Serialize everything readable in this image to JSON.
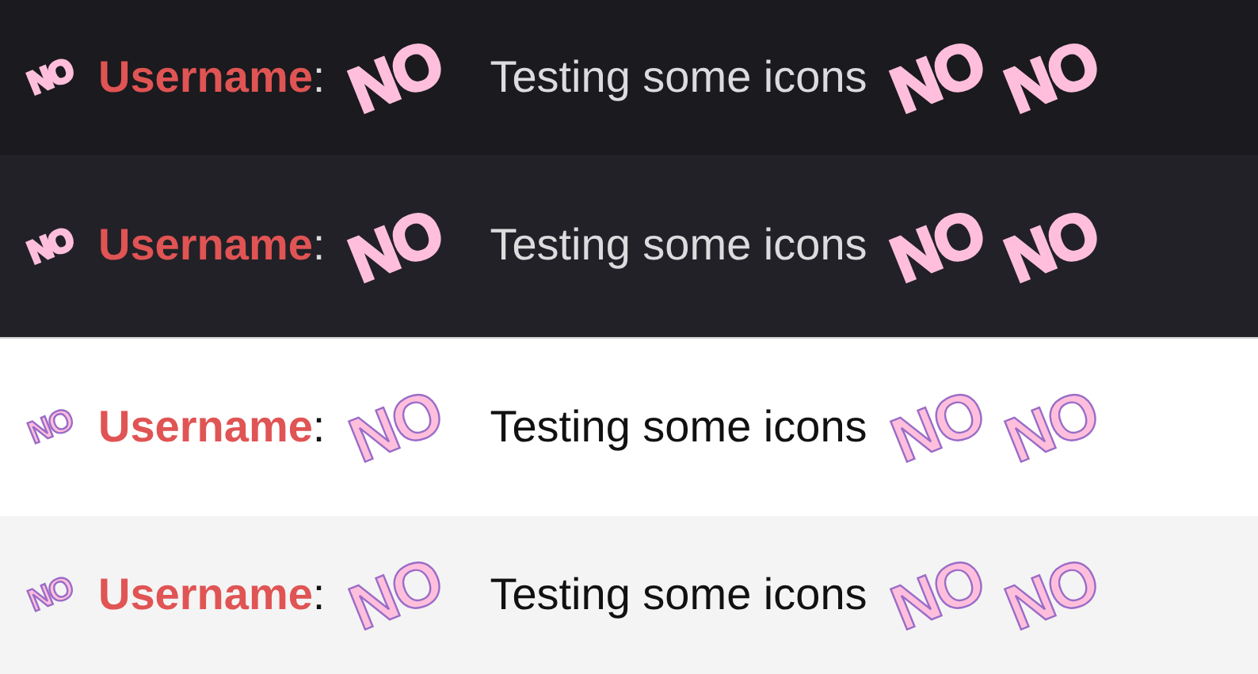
{
  "rows": [
    {
      "kind": "dark",
      "segments": [
        {
          "kind": "small-emoji",
          "text": "NO"
        },
        {
          "kind": "username",
          "text": "Username"
        },
        {
          "kind": "colon",
          "text": ":"
        },
        {
          "kind": "emoji",
          "text": "NO"
        },
        {
          "kind": "message",
          "text": "Testing some icons"
        },
        {
          "kind": "emoji",
          "text": "NO"
        },
        {
          "kind": "emoji",
          "text": "NO"
        }
      ]
    },
    {
      "kind": "darker",
      "segments": [
        {
          "kind": "small-emoji",
          "text": "NO"
        },
        {
          "kind": "username",
          "text": "Username"
        },
        {
          "kind": "colon",
          "text": ":"
        },
        {
          "kind": "emoji",
          "text": "NO"
        },
        {
          "kind": "message",
          "text": "Testing some icons"
        },
        {
          "kind": "emoji",
          "text": "NO"
        },
        {
          "kind": "emoji",
          "text": "NO"
        }
      ]
    },
    {
      "kind": "light",
      "segments": [
        {
          "kind": "small-emoji",
          "text": "NO"
        },
        {
          "kind": "username",
          "text": "Username"
        },
        {
          "kind": "colon",
          "text": ":"
        },
        {
          "kind": "emoji",
          "text": "NO"
        },
        {
          "kind": "message",
          "text": "Testing some icons"
        },
        {
          "kind": "emoji",
          "text": "NO"
        },
        {
          "kind": "emoji",
          "text": "NO"
        }
      ]
    },
    {
      "kind": "gray",
      "segments": [
        {
          "kind": "small-emoji",
          "text": "NO"
        },
        {
          "kind": "username",
          "text": "Username"
        },
        {
          "kind": "colon",
          "text": ":"
        },
        {
          "kind": "emoji",
          "text": "NO"
        },
        {
          "kind": "message",
          "text": "Testing some icons"
        },
        {
          "kind": "emoji",
          "text": "NO"
        },
        {
          "kind": "emoji",
          "text": "NO"
        }
      ]
    }
  ]
}
